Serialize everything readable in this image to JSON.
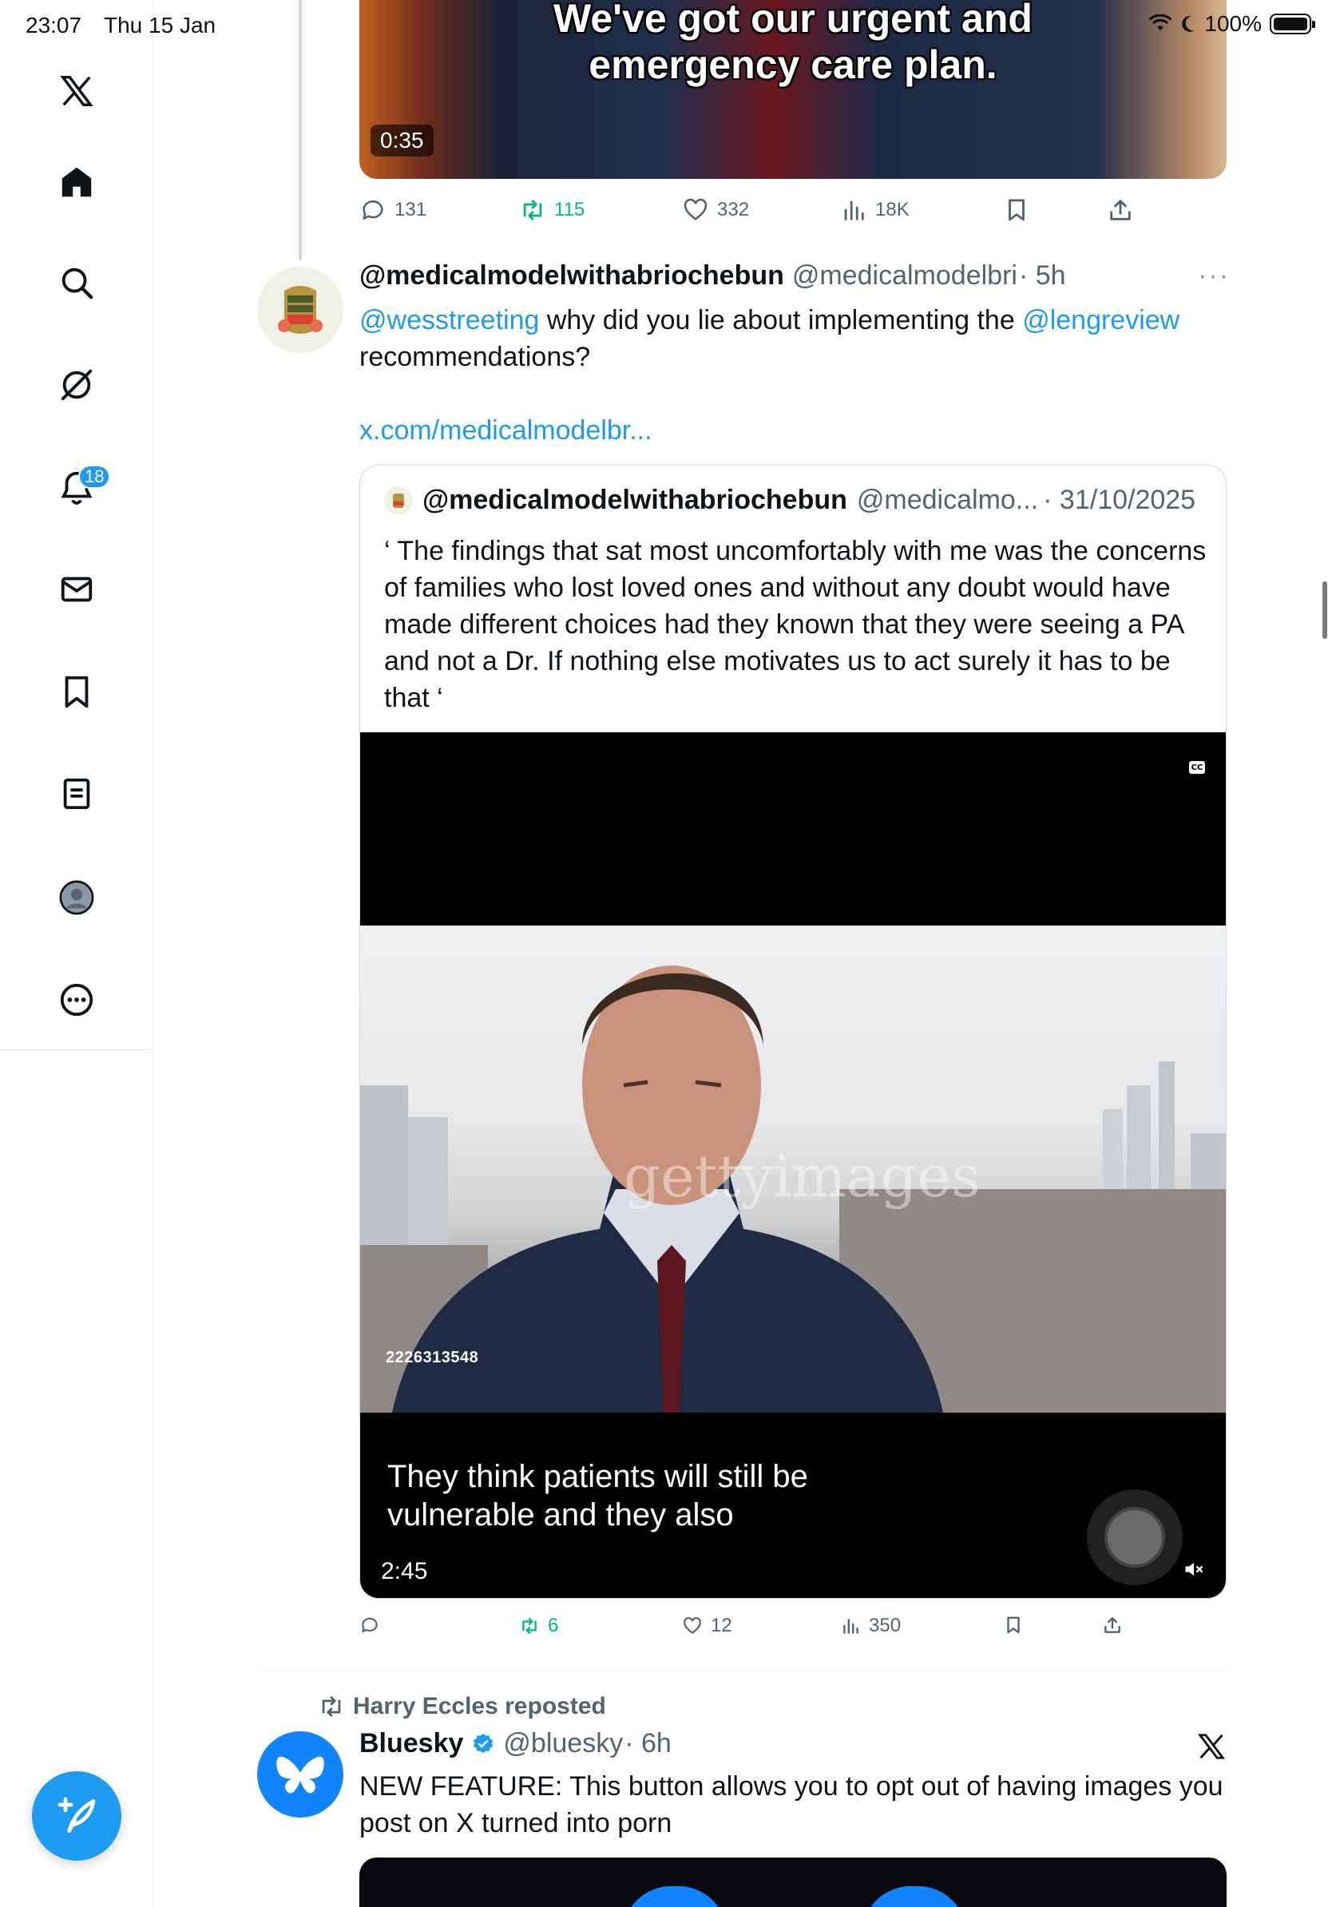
{
  "status_bar": {
    "time": "23:07",
    "date": "Thu 15 Jan",
    "battery": "100%"
  },
  "sidebar": {
    "items": [
      {
        "name": "x-logo-icon"
      },
      {
        "name": "home-icon"
      },
      {
        "name": "search-icon"
      },
      {
        "name": "grok-icon"
      },
      {
        "name": "notifications-icon",
        "badge": "18"
      },
      {
        "name": "messages-icon"
      },
      {
        "name": "bookmarks-icon"
      },
      {
        "name": "lists-icon"
      },
      {
        "name": "profile-icon"
      },
      {
        "name": "more-icon"
      }
    ],
    "compose_icon": "compose-post-icon"
  },
  "top_video": {
    "caption_line1": "We've got our urgent and",
    "caption_line2": "emergency care plan.",
    "duration": "0:35"
  },
  "top_actions": {
    "replies": "131",
    "reposts": "115",
    "likes": "332",
    "views": "18K"
  },
  "tweet": {
    "display_name": "@medicalmodelwithabriochebun",
    "handle": "@medicalmodelbri",
    "time": "· 5h",
    "more": "···",
    "mention1": "@wesstreeting",
    "text_mid": " why did you lie about implementing the ",
    "mention2": "@lengreview",
    "text_end": " recommendations?",
    "link": "x.com/medicalmodelbr..."
  },
  "quote": {
    "display_name": "@medicalmodelwithabriochebun",
    "handle": "@medicalmo...",
    "time": "· 31/10/2025",
    "text": "‘ The findings that sat most uncomfortably with me was the concerns of families who lost loved ones and without any doubt would have made different choices had they known that they were seeing a PA and not a Dr. If nothing else motivates us to act surely it has to be that ‘",
    "video": {
      "cc": "CC",
      "watermark": "gettyimages",
      "image_id": "2226313548",
      "subtitle_line1": "They think patients will still be",
      "subtitle_line2": "vulnerable and they also",
      "duration": "2:45"
    }
  },
  "quote_actions": {
    "replies": "",
    "reposts": "6",
    "likes": "12",
    "views": "350"
  },
  "repost": {
    "label": "Harry Eccles reposted"
  },
  "tweet2": {
    "display_name": "Bluesky",
    "handle": "@bluesky",
    "time": "· 6h",
    "text": "NEW FEATURE: This button allows you to opt out of having images you post on X turned into porn"
  },
  "colors": {
    "accent": "#1d9bf0",
    "repost_green": "#00ba7c",
    "muted_text": "#536471",
    "bluesky_blue": "#1185fe"
  }
}
